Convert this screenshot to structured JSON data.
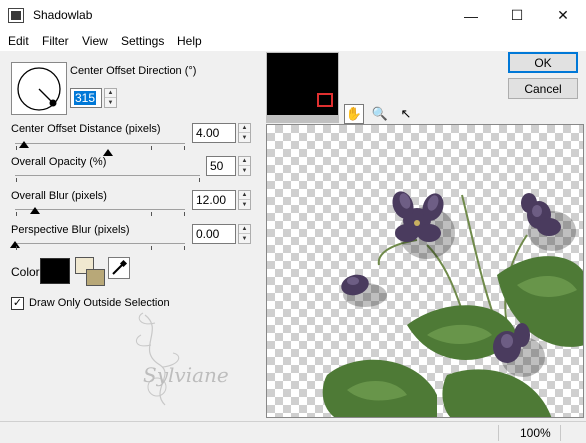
{
  "window": {
    "title": "Shadowlab",
    "minimize": "—",
    "maximize": "☐",
    "close": "✕"
  },
  "menu": {
    "items": [
      "Edit",
      "Filter",
      "View",
      "Settings",
      "Help"
    ]
  },
  "controls": {
    "direction": {
      "label": "Center Offset Direction (°)",
      "value": "315"
    },
    "distance": {
      "label": "Center Offset Distance (pixels)",
      "value": "4.00",
      "level_percent": 5
    },
    "opacity": {
      "label": "Overall Opacity (%)",
      "value": "50",
      "level_percent": 50
    },
    "blur": {
      "label": "Overall Blur (pixels)",
      "value": "12.00",
      "level_percent": 12
    },
    "perspective_blur": {
      "label": "Perspective Blur (pixels)",
      "value": "0.00",
      "level_percent": 0
    },
    "color": {
      "label": "Color",
      "shadow_color": "#000000",
      "bg_color": "#f0e8d0",
      "fg_color": "#b8a878",
      "eyedropper_icon": "eyedropper-icon"
    },
    "draw_outside": {
      "label": "Draw Only Outside Selection",
      "checked": true,
      "mark": "✓"
    }
  },
  "buttons": {
    "ok": "OK",
    "cancel": "Cancel"
  },
  "tools": {
    "hand": "✋",
    "zoom": "🔍",
    "arrow": "↖"
  },
  "watermark": {
    "text": "Sylviane"
  },
  "status": {
    "zoom": "100%"
  }
}
